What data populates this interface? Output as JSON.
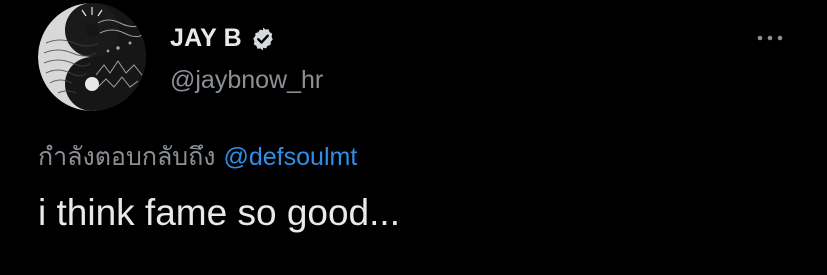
{
  "author": {
    "display_name": "JAY B",
    "handle": "@jaybnow_hr",
    "verified": true,
    "avatar_icon": "yin-yang-avatar-icon",
    "verified_icon": "verified-badge-icon"
  },
  "menu": {
    "more_icon": "more-options-icon"
  },
  "reply": {
    "prefix": "กำลังตอบกลับถึง",
    "mention": "@defsoulmt"
  },
  "tweet": {
    "text": "i think fame so good..."
  },
  "colors": {
    "background": "#000000",
    "primary_text": "#e7e9ea",
    "secondary_text": "#8b9096",
    "link": "#2f8fe8"
  }
}
